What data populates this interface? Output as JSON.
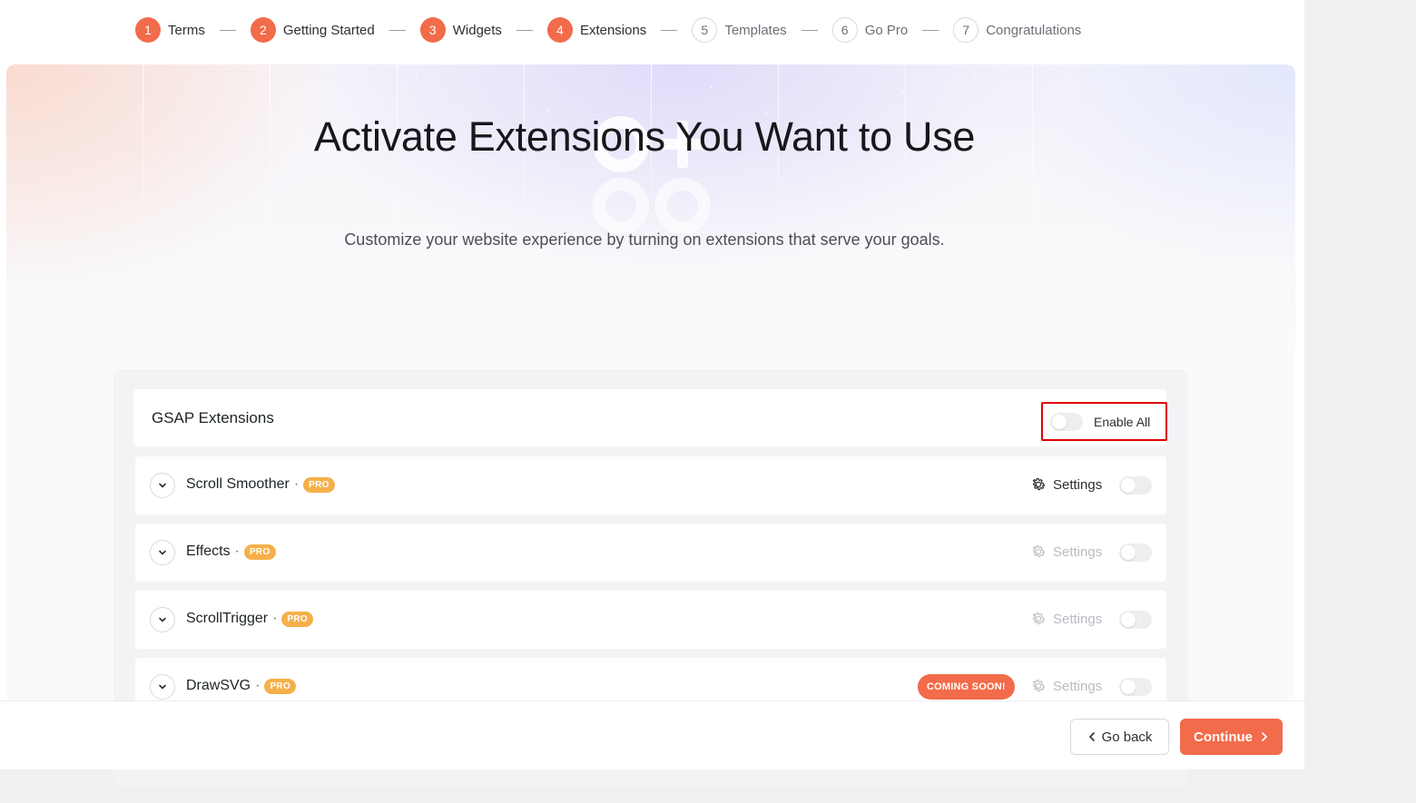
{
  "stepper": {
    "steps": [
      {
        "num": "1",
        "label": "Terms",
        "state": "done"
      },
      {
        "num": "2",
        "label": "Getting Started",
        "state": "done"
      },
      {
        "num": "3",
        "label": "Widgets",
        "state": "done"
      },
      {
        "num": "4",
        "label": "Extensions",
        "state": "done"
      },
      {
        "num": "5",
        "label": "Templates",
        "state": "todo"
      },
      {
        "num": "6",
        "label": "Go Pro",
        "state": "todo"
      },
      {
        "num": "7",
        "label": "Congratulations",
        "state": "todo"
      }
    ]
  },
  "hero": {
    "title": "Activate Extensions You Want to Use",
    "subtitle": "Customize your website experience by turning on extensions that serve your goals."
  },
  "group": {
    "title": "GSAP Extensions",
    "enable_all_label": "Enable All",
    "enable_all_on": false
  },
  "extensions": [
    {
      "name": "Scroll Smoother",
      "separator": "·",
      "badge": "PRO",
      "settings_label": "Settings",
      "settings_enabled": true,
      "toggle_on": false
    },
    {
      "name": "Effects",
      "separator": "·",
      "badge": "PRO",
      "settings_label": "Settings",
      "settings_enabled": false,
      "toggle_on": false
    },
    {
      "name": "ScrollTrigger",
      "separator": "·",
      "badge": "PRO",
      "settings_label": "Settings",
      "settings_enabled": false,
      "toggle_on": false
    },
    {
      "name": "DrawSVG",
      "separator": "·",
      "badge": "PRO",
      "coming_soon": "COMING SOON!",
      "settings_label": "Settings",
      "settings_enabled": false,
      "toggle_on": false
    }
  ],
  "footer": {
    "back_label": "Go back",
    "continue_label": "Continue"
  },
  "colors": {
    "accent": "#f26b4a",
    "pro_badge": "#f5b049",
    "highlight_box": "#e00000"
  },
  "icons": {
    "chevron": "chevron-down-icon",
    "settings": "gear-icon",
    "back": "chevron-left-icon",
    "continue": "chevron-right-icon"
  }
}
